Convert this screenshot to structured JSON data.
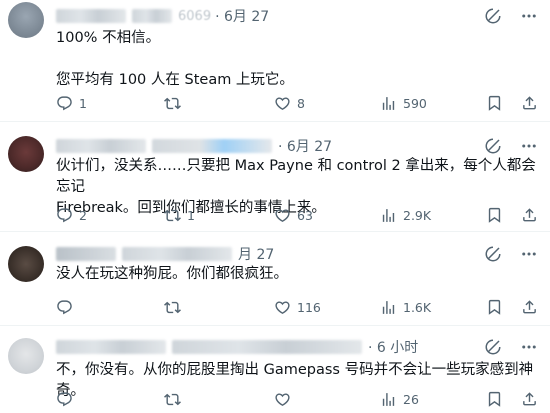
{
  "posts": [
    {
      "handle_visible": "6069",
      "timestamp": "· 6月 27",
      "text": "100% 不相信。\n\n您平均有 100 人在 Steam 上玩它。",
      "replies": "1",
      "reposts": "",
      "likes": "8",
      "views": "590"
    },
    {
      "handle_visible": "",
      "timestamp": "· 6月 27",
      "text": "伙计们，没关系……只要把 Max Payne 和 control 2 拿出来，每个人都会忘记\nFirebreak。回到你们都擅长的事情上来。",
      "replies": "2",
      "reposts": "1",
      "likes": "63",
      "views": "2.9K"
    },
    {
      "handle_visible": "",
      "timestamp": "月 27",
      "text": "没人在玩这种狗屁。你们都很疯狂。",
      "replies": "",
      "reposts": "",
      "likes": "116",
      "views": "1.6K"
    },
    {
      "handle_visible": "",
      "timestamp": "· 6 小时",
      "text": "不，你没有。从你的屁股里掏出 Gamepass 号码并不会让一些玩家感到神奇。",
      "replies": "",
      "reposts": "",
      "likes": "",
      "views": "26"
    }
  ],
  "icons": {
    "reply": "reply-icon",
    "repost": "repost-icon",
    "like": "heart-icon",
    "views": "views-icon",
    "bookmark": "bookmark-icon",
    "share": "share-icon",
    "grok": "grok-icon",
    "more": "more-icon"
  },
  "colors": {
    "text": "#0f1419",
    "secondary": "#536471",
    "divider": "#eff3f4"
  }
}
